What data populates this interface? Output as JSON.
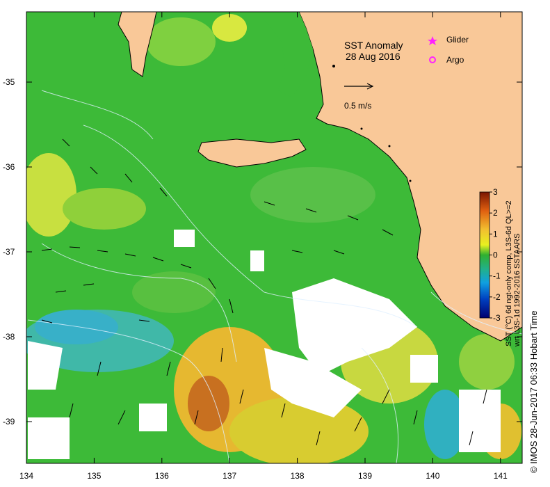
{
  "map": {
    "title": "SST Anomaly",
    "date": "28 Aug 2016",
    "legend": {
      "glider": "Glider",
      "argo": "Argo"
    },
    "scale_label": "0.5 m/s",
    "x_ticks": [
      "134",
      "135",
      "136",
      "137",
      "138",
      "139",
      "140",
      "141"
    ],
    "y_ticks": [
      "-35",
      "-36",
      "-37",
      "-38",
      "-39"
    ],
    "colorbar": {
      "ticks": [
        "3",
        "2",
        "1",
        "0",
        "-1",
        "-2",
        "-3"
      ],
      "title_line1": "SST (°C) 6d ngt-only comp, L3S-6d QL>=2",
      "title_line2": "wrt L3S-1d 1992-2016 SSTAARS"
    },
    "credit": "© IMOS 28-Jun-2017 06:33 Hobart Time",
    "colors": {
      "land": "#f9c898",
      "ocean_base": "#3dba38",
      "warm": "#e8a020",
      "cool": "#30b0d0"
    }
  }
}
